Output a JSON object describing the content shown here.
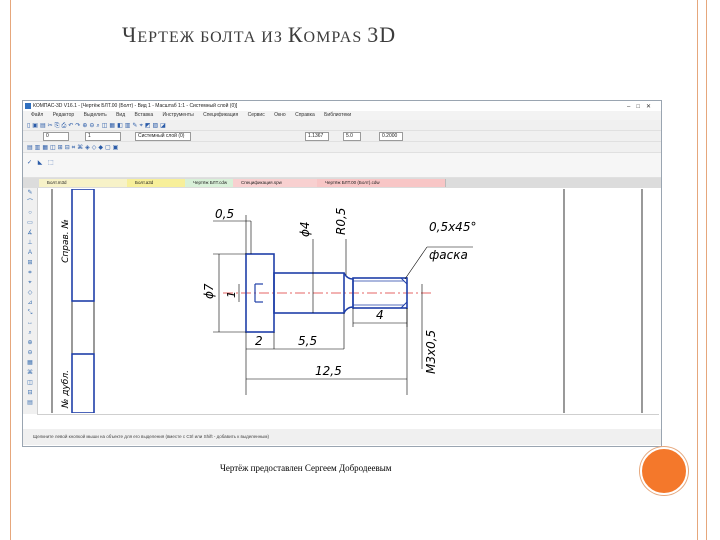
{
  "slide": {
    "title_parts": [
      {
        "text": "Ч",
        "big": true
      },
      {
        "text": "ЕРТЕЖ БОЛТА ИЗ ",
        "big": false
      },
      {
        "text": "К",
        "big": true
      },
      {
        "text": "OMPAS ",
        "big": false
      },
      {
        "text": "3D",
        "big": true
      }
    ],
    "caption": "Чертёж предоставлен Сергеем Добродеевым"
  },
  "app": {
    "window_title": "КОМПАС-3D V16.1 - [Чертёж БЛТ.00 (Болт) - Вид 1 - Масштаб 1:1 - Системный слой (0)]",
    "menu": [
      "Файл",
      "Редактор",
      "Выделить",
      "Вид",
      "Вставка",
      "Инструменты",
      "Спецификация",
      "Сервис",
      "Окно",
      "Справка",
      "Библиотеки"
    ],
    "toolbar2": {
      "layer_value": "0",
      "scale_value": "1",
      "layer_name": "Системный слой (0)",
      "zoom": "1.1367",
      "step": "5.0",
      "angle": "0.2000"
    },
    "tabs": [
      "Болт.m3d",
      "Болт.a3d",
      "Чертёж БЛТ.cdw",
      "Спецификация.spw",
      "Чертёж БЛТ.00 (Болт).cdw"
    ],
    "status": "Щелкните левой кнопкой мыши на объекте для его выделения (вместе с Ctrl или Shift - добавить к выделенным)"
  },
  "drawing": {
    "dims": {
      "d_top": "0,5",
      "d_phi4": "ϕ4",
      "d_r05": "R0,5",
      "d_chamfer": "0,5x45°",
      "d_chamfer_note": "фаска",
      "d_phi7": "ϕ7",
      "d_one": "1",
      "d_four": "4",
      "d_thread": "M3x0,5",
      "d_two": "2",
      "d_55": "5,5",
      "d_125": "12,5"
    },
    "side_left": "Справ. №",
    "side_left2": "№ дубл."
  },
  "colors": {
    "accent": "#f4782b",
    "frame": "#e6a77c",
    "part_line": "#1f3fa8",
    "dim": "#000000"
  }
}
